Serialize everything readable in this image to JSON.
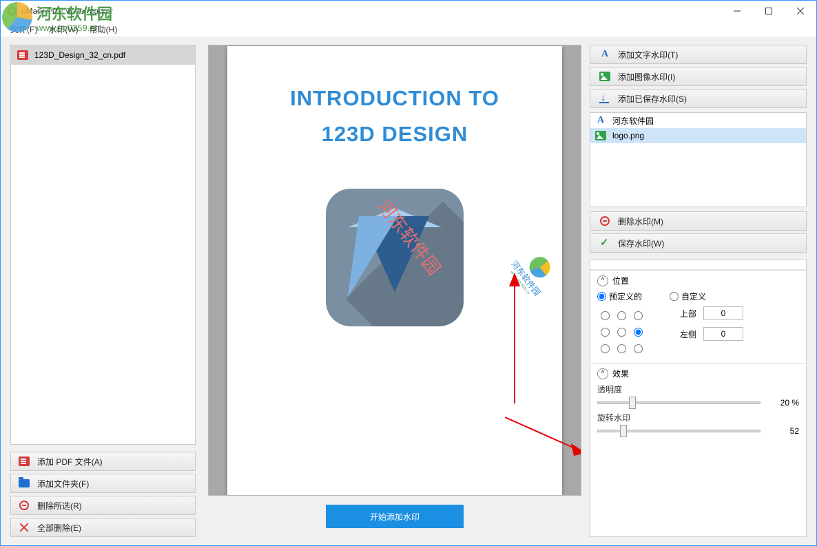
{
  "window": {
    "title": "uMark PDF Watermarker"
  },
  "menubar": {
    "file": "文件(F)",
    "watermark": "水印(W)",
    "help": "帮助(H)"
  },
  "overlay": {
    "brand": "河东软件园",
    "url": "www.pc0359.cn"
  },
  "left": {
    "files": [
      "123D_Design_32_cn.pdf"
    ],
    "add_pdf": "添加 PDF 文件(A)",
    "add_folder": "添加文件夹(F)",
    "del_sel": "删除所选(R)",
    "del_all": "全部删除(E)"
  },
  "preview": {
    "heading_line1": "INTRODUCTION TO",
    "heading_line2": "123D DESIGN",
    "wm_text": "河东软件园",
    "wm_logo_text": "河东软件园",
    "wm_logo_url": "www.pc0359.cn"
  },
  "bottom": {
    "start": "开始添加水印"
  },
  "right": {
    "add_text": "添加文字水印(T)",
    "add_image": "添加图像水印(I)",
    "add_saved": "添加已保存水印(S)",
    "wm_items": [
      {
        "kind": "text",
        "label": "河东软件园"
      },
      {
        "kind": "image",
        "label": "logo.png"
      }
    ],
    "del_wm": "删除水印(M)",
    "save_wm": "保存水印(W)",
    "pos": {
      "title": "位置",
      "predef": "预定义的",
      "custom": "自定义",
      "top": "上部",
      "left": "左侧",
      "top_val": "0",
      "left_val": "0",
      "grid_index": 5
    },
    "fx": {
      "title": "效果",
      "opacity": "透明度",
      "opacity_val": "20",
      "opacity_pct": "20 %",
      "rotate": "旋转水印",
      "rotate_val": "52",
      "rotate_txt": "52"
    }
  }
}
